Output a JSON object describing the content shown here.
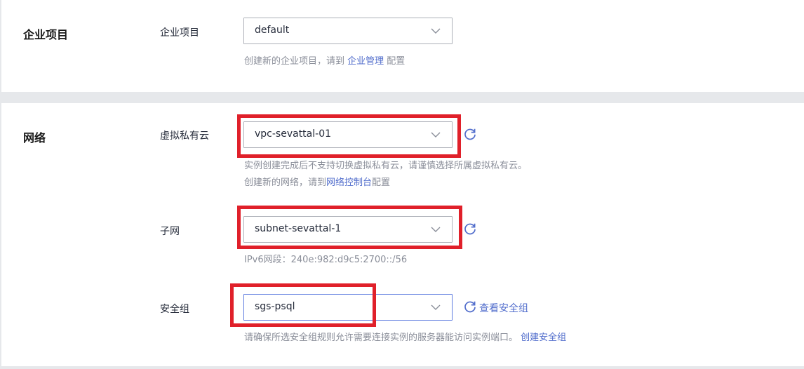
{
  "enterprise_section": {
    "title": "企业项目",
    "field_label": "企业项目",
    "selected_value": "default",
    "hint_prefix": "创建新的企业项目，请到 ",
    "hint_link": "企业管理",
    "hint_suffix": " 配置"
  },
  "network_section": {
    "title": "网络",
    "vpc": {
      "label": "虚拟私有云",
      "selected_value": "vpc-sevattal-01",
      "hint_line1": "实例创建完成后不支持切换虚拟私有云，请谨慎选择所属虚拟私有云。",
      "hint_line2_prefix": "创建新的网络，请到",
      "hint_line2_link": "网络控制台",
      "hint_line2_suffix": "配置"
    },
    "subnet": {
      "label": "子网",
      "selected_value": "subnet-sevattal-1",
      "hint": "IPv6网段：240e:982:d9c5:2700::/56"
    },
    "security_group": {
      "label": "安全组",
      "selected_value": "sgs-psql",
      "view_link": "查看安全组",
      "hint_prefix": "请确保所选安全组规则允许需要连接实例的服务器能访问实例端口。 ",
      "hint_link": "创建安全组"
    }
  },
  "colors": {
    "accent": "#526ecc",
    "highlight": "#e0202a"
  },
  "icons": {
    "dropdown": "chevron-down-icon",
    "refresh": "refresh-icon"
  }
}
